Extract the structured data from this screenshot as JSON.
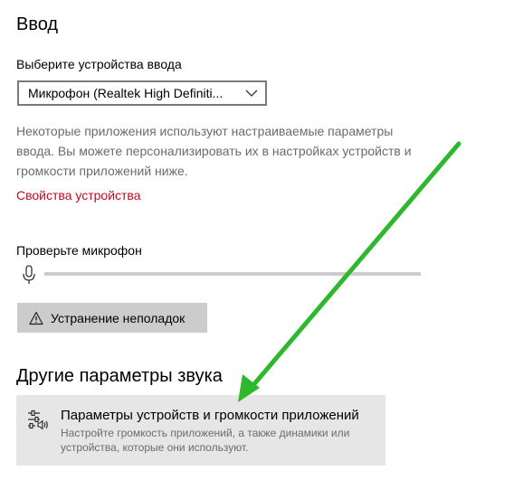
{
  "input_section": {
    "title": "Ввод",
    "select_label": "Выберите устройства ввода",
    "selected_device": "Микрофон (Realtek High Definiti...",
    "description": "Некоторые приложения используют настраиваемые параметры ввода. Вы можете персонализировать их в настройках устройств и громкости приложений ниже.",
    "device_properties_link": "Свойства устройства",
    "test_mic_label": "Проверьте микрофон",
    "mic_level": 0,
    "troubleshoot_button": "Устранение неполадок"
  },
  "other_section": {
    "title": "Другие параметры звука",
    "app_volume_title": "Параметры устройств и громкости приложений",
    "app_volume_subtitle": "Настройте громкость приложений, а также динамики или устройства, которые они используют."
  },
  "colors": {
    "link": "#c4091f",
    "annotation_arrow": "#2db82d",
    "button_bg": "#cccccc",
    "card_bg": "#e6e6e6"
  },
  "icons": {
    "select_chevron": "chevron-down-icon",
    "mic": "microphone-icon",
    "warning": "warning-icon",
    "app_volume": "sliders-speaker-icon"
  }
}
